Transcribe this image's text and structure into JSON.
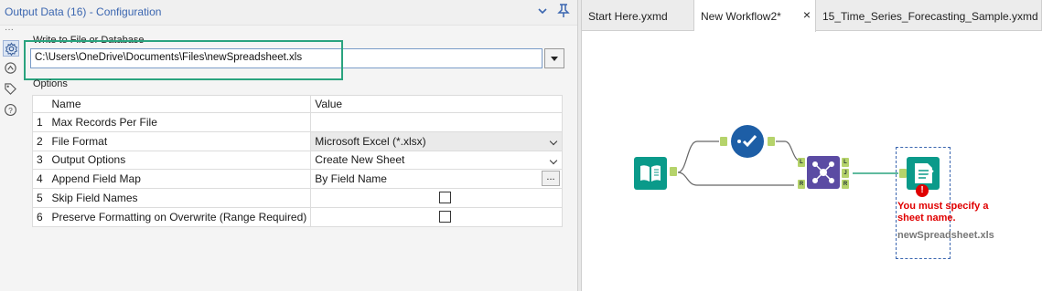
{
  "config_panel": {
    "title": "Output Data (16) - Configuration",
    "collapse_icon": "chevron-down-icon",
    "pin_icon": "pin-icon",
    "side_icons": [
      "settings-icon",
      "view-icon",
      "tag-icon",
      "help-icon"
    ],
    "write_label": "Write to File or Database",
    "file_path": "C:\\Users\\OneDrive\\Documents\\Files\\newSpreadsheet.xls",
    "options_label": "Options",
    "columns": {
      "name": "Name",
      "value": "Value"
    },
    "rows": [
      {
        "index": "1",
        "name": "Max Records Per File",
        "value": ""
      },
      {
        "index": "2",
        "name": "File Format",
        "value": "Microsoft Excel (*.xlsx)"
      },
      {
        "index": "3",
        "name": "Output Options",
        "value": "Create New Sheet"
      },
      {
        "index": "4",
        "name": "Append Field Map",
        "value": "By Field Name",
        "button": "..."
      },
      {
        "index": "5",
        "name": "Skip Field Names",
        "checked": false
      },
      {
        "index": "6",
        "name": "Preserve Formatting on Overwrite (Range Required)",
        "checked": false
      }
    ],
    "highlight_color": "#2aa37e"
  },
  "tabs": [
    {
      "label": "Start Here.yxmd",
      "active": false
    },
    {
      "label": "New Workflow2*",
      "active": true
    },
    {
      "label": "15_Time_Series_Forecasting_Sample.yxmd",
      "active": false
    }
  ],
  "tab_close": "×",
  "workflow": {
    "tools": [
      "input-data-tool-icon",
      "select-tool-icon",
      "join-tool-icon",
      "output-data-tool-icon"
    ],
    "anchor_labels": {
      "left": "L",
      "join": "J",
      "right": "R"
    },
    "error_message": "You must specify a sheet name.",
    "output_file": "newSpreadsheet.xls",
    "colors": {
      "tool_teal": "#0a9a8a",
      "select_blue": "#1d5ea6",
      "join_purple": "#5b4ba3",
      "error_red": "#e00000",
      "anchor_green": "#b5d36b"
    }
  }
}
